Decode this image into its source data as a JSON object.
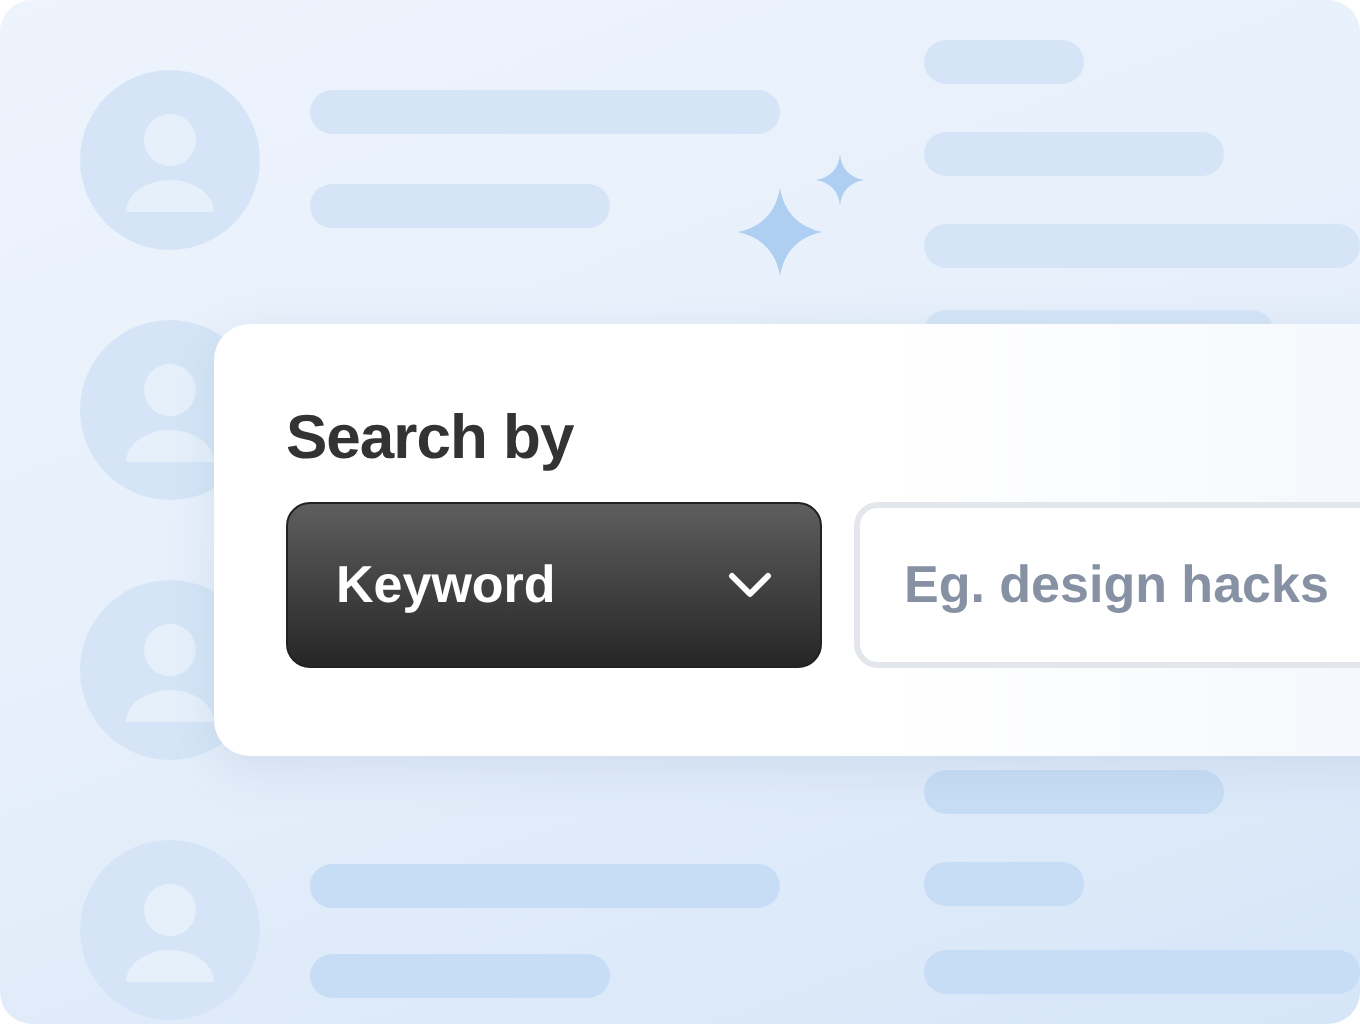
{
  "heading": "Search by",
  "dropdown": {
    "value": "Keyword"
  },
  "search": {
    "placeholder": "Eg. design hacks"
  }
}
